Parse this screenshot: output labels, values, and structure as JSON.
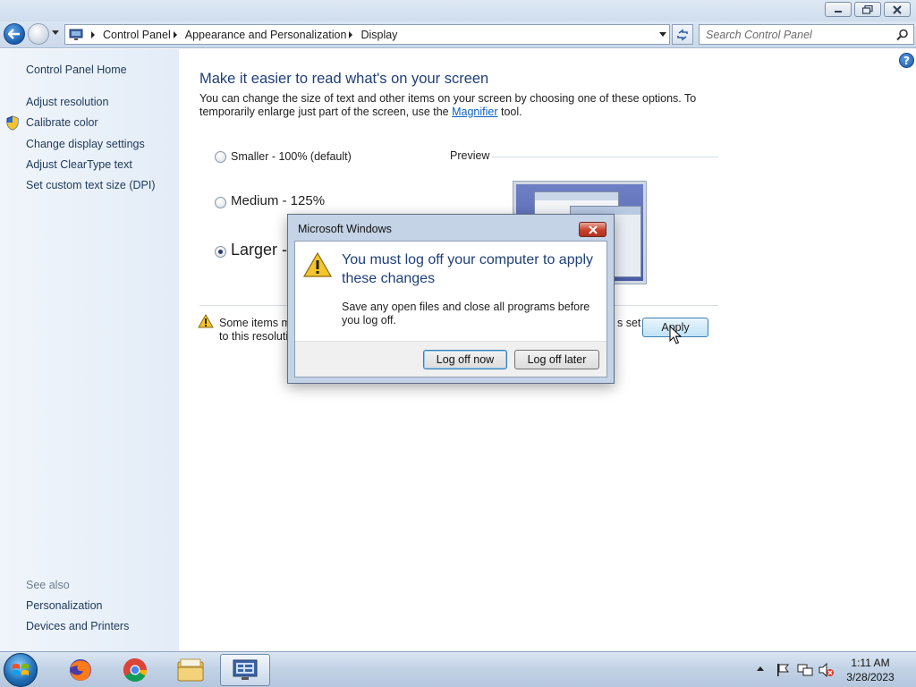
{
  "titlebar": {
    "buttons": [
      "minimize-icon",
      "restore-icon",
      "close-icon"
    ]
  },
  "address": {
    "breadcrumbs": [
      "Control Panel",
      "Appearance and Personalization",
      "Display"
    ],
    "search_placeholder": "Search Control Panel"
  },
  "sidebar": {
    "home": "Control Panel Home",
    "items": [
      {
        "label": "Adjust resolution",
        "icon": ""
      },
      {
        "label": "Calibrate color",
        "icon": "shield-icon"
      },
      {
        "label": "Change display settings",
        "icon": ""
      },
      {
        "label": "Adjust ClearType text",
        "icon": ""
      },
      {
        "label": "Set custom text size (DPI)",
        "icon": ""
      }
    ],
    "see_also_label": "See also",
    "see_also": [
      "Personalization",
      "Devices and Printers"
    ]
  },
  "main": {
    "heading": "Make it easier to read what's on your screen",
    "intro_before_link": "You can change the size of text and other items on your screen by choosing one of these options. To temporarily enlarge just part of the screen, use the ",
    "intro_link": "Magnifier",
    "intro_after_link": " tool.",
    "options": [
      {
        "label": "Smaller - 100% (default)",
        "checked": false
      },
      {
        "label": "Medium - 125%",
        "checked": false
      },
      {
        "label": "Larger -",
        "checked": true
      }
    ],
    "preview_label": "Preview",
    "warning_text_visible": "Some items m",
    "warning_text_line2": "to this resolutio",
    "warning_text_tail": "s set",
    "apply_label": "Apply"
  },
  "dialog": {
    "title": "Microsoft Windows",
    "heading": "You must log off your computer to apply these changes",
    "message": "Save any open files and close all programs before you log off.",
    "primary_button": "Log off now",
    "secondary_button": "Log off later"
  },
  "taskbar": {
    "apps": [
      "firefox-icon",
      "chrome-icon",
      "explorer-icon",
      "control-panel-icon"
    ],
    "active_app": "control-panel-icon",
    "time": "1:11 AM",
    "date": "3/28/2023"
  },
  "colors": {
    "heading_blue": "#1e3f77",
    "link_blue": "#1e395b",
    "close_red": "#c7402b"
  }
}
